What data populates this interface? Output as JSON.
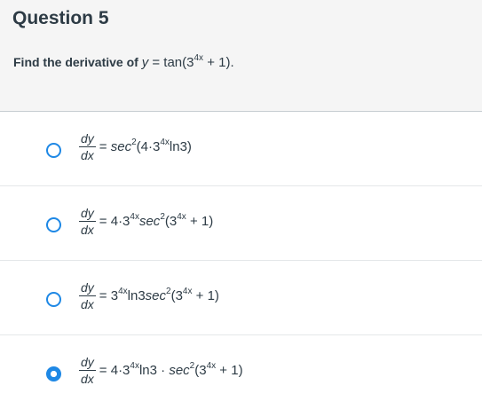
{
  "question": {
    "title": "Question 5",
    "prompt_prefix": "Find the derivative of",
    "prompt_y": "y",
    "prompt_eq": " = tan(3",
    "prompt_exp": "4x",
    "prompt_end": " + 1)."
  },
  "answers": [
    {
      "selected": false,
      "dy": "dy",
      "dx": "dx",
      "parts": [
        {
          "t": "= "
        },
        {
          "t": "sec",
          "i": true
        },
        {
          "t": "2",
          "s": true
        },
        {
          "t": "(4·3"
        },
        {
          "t": "4x",
          "s": true
        },
        {
          "t": "ln3)"
        }
      ]
    },
    {
      "selected": false,
      "dy": "dy",
      "dx": "dx",
      "parts": [
        {
          "t": "= 4·3"
        },
        {
          "t": "4x",
          "s": true
        },
        {
          "t": "sec",
          "i": true
        },
        {
          "t": "2",
          "s": true
        },
        {
          "t": "(3"
        },
        {
          "t": "4x",
          "s": true
        },
        {
          "t": " + 1)"
        }
      ]
    },
    {
      "selected": false,
      "dy": "dy",
      "dx": "dx",
      "parts": [
        {
          "t": "= 3"
        },
        {
          "t": "4x",
          "s": true
        },
        {
          "t": "ln3"
        },
        {
          "t": "sec",
          "i": true
        },
        {
          "t": "2",
          "s": true
        },
        {
          "t": "(3"
        },
        {
          "t": "4x",
          "s": true
        },
        {
          "t": " + 1)"
        }
      ]
    },
    {
      "selected": true,
      "dy": "dy",
      "dx": "dx",
      "parts": [
        {
          "t": "= 4·3"
        },
        {
          "t": "4x",
          "s": true
        },
        {
          "t": "ln3 · "
        },
        {
          "t": "sec",
          "i": true
        },
        {
          "t": "2",
          "s": true
        },
        {
          "t": "(3"
        },
        {
          "t": "4x",
          "s": true
        },
        {
          "t": " + 1)"
        }
      ]
    }
  ],
  "colors": {
    "accent": "#1e88e5",
    "header_bg": "#f5f5f5",
    "text": "#2d3b45"
  }
}
